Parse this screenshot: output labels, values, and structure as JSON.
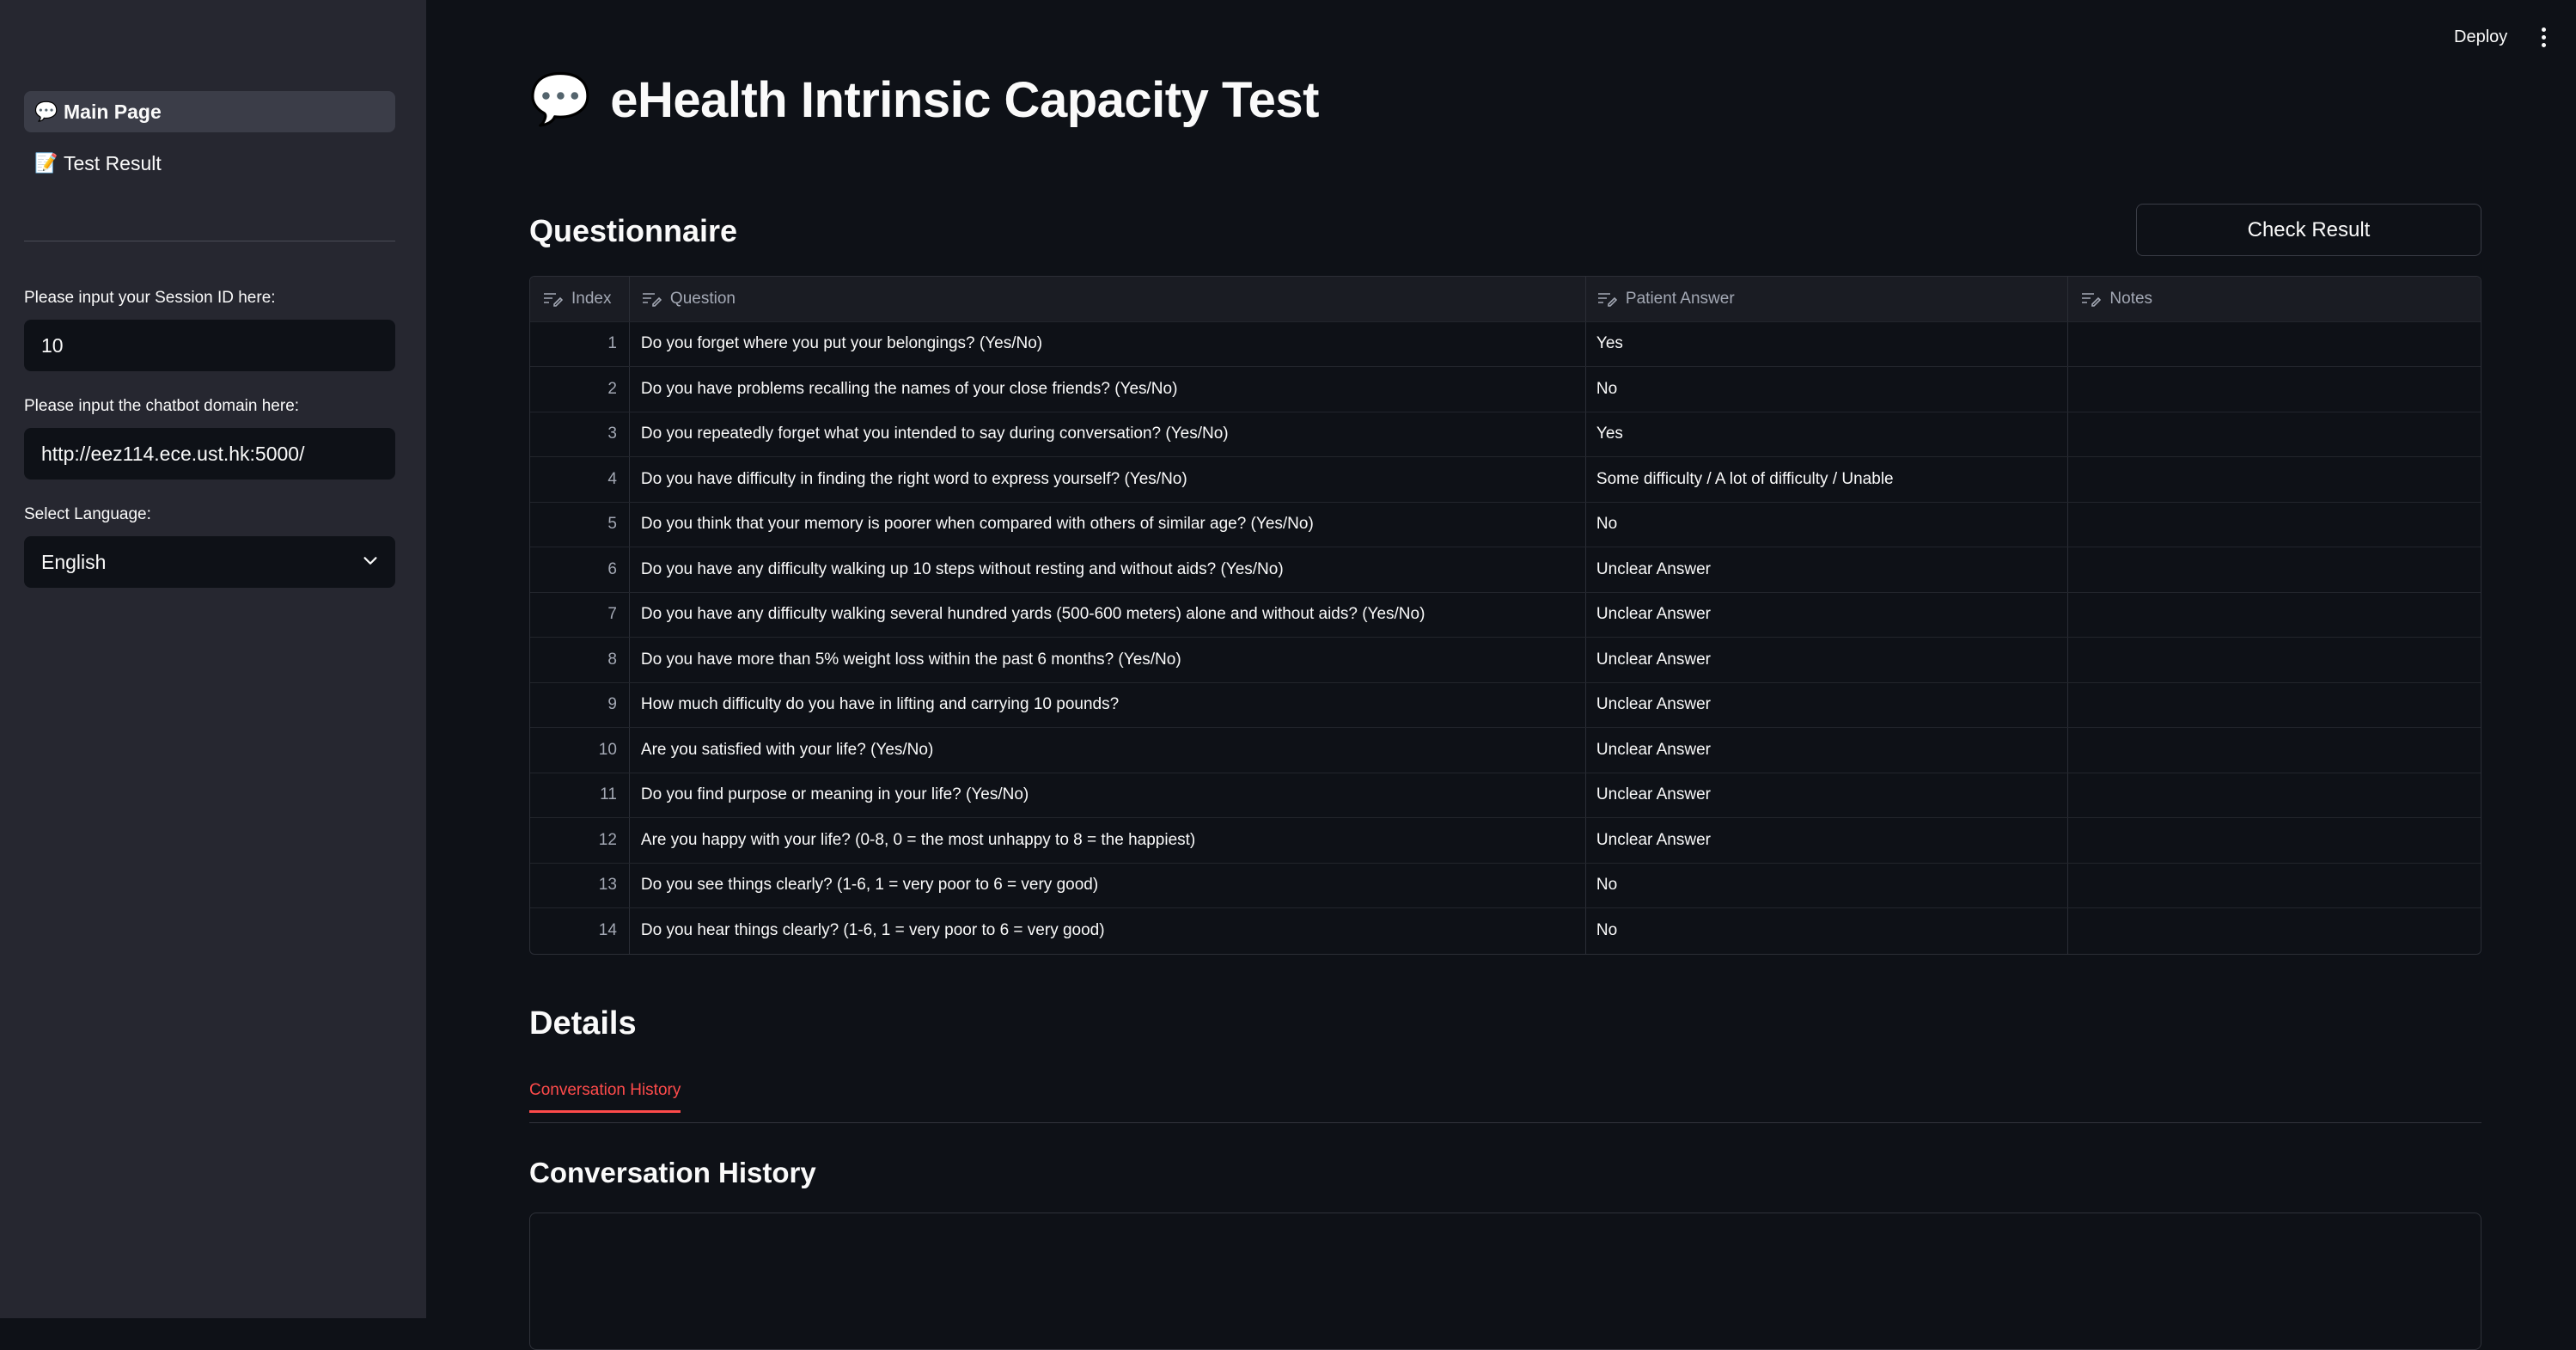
{
  "sidebar": {
    "nav": [
      {
        "icon": "💬",
        "label": "Main Page",
        "active": true
      },
      {
        "icon": "📝",
        "label": "Test Result",
        "active": false
      }
    ],
    "session_label": "Please input your Session ID here:",
    "session_value": "10",
    "domain_label": "Please input the chatbot domain here:",
    "domain_value": "http://eez114.ece.ust.hk:5000/",
    "language_label": "Select Language:",
    "language_value": "English"
  },
  "header": {
    "deploy": "Deploy",
    "menu_icon": "kebab-menu-icon"
  },
  "page": {
    "icon": "💬",
    "title": "eHealth Intrinsic Capacity Test"
  },
  "questionnaire": {
    "heading": "Questionnaire",
    "check_button": "Check Result",
    "columns": [
      "Index",
      "Question",
      "Patient Answer",
      "Notes"
    ],
    "rows": [
      {
        "index": "1",
        "question": "Do you forget where you put your belongings? (Yes/No)",
        "answer": "Yes",
        "notes": ""
      },
      {
        "index": "2",
        "question": "Do you have problems recalling the names of your close friends? (Yes/No)",
        "answer": "No",
        "notes": ""
      },
      {
        "index": "3",
        "question": "Do you repeatedly forget what you intended to say during conversation? (Yes/No)",
        "answer": "Yes",
        "notes": ""
      },
      {
        "index": "4",
        "question": "Do you have difficulty in finding the right word to express yourself? (Yes/No)",
        "answer": "Some difficulty / A lot of difficulty / Unable",
        "notes": ""
      },
      {
        "index": "5",
        "question": "Do you think that your memory is poorer when compared with others of similar age? (Yes/No)",
        "answer": "No",
        "notes": ""
      },
      {
        "index": "6",
        "question": "Do you have any difficulty walking up 10 steps without resting and without aids? (Yes/No)",
        "answer": "Unclear Answer",
        "notes": ""
      },
      {
        "index": "7",
        "question": "Do you have any difficulty walking several hundred yards (500-600 meters) alone and without aids? (Yes/No)",
        "answer": "Unclear Answer",
        "notes": ""
      },
      {
        "index": "8",
        "question": "Do you have more than 5% weight loss within the past 6 months? (Yes/No)",
        "answer": "Unclear Answer",
        "notes": ""
      },
      {
        "index": "9",
        "question": "How much difficulty do you have in lifting and carrying 10 pounds?",
        "answer": "Unclear Answer",
        "notes": ""
      },
      {
        "index": "10",
        "question": "Are you satisfied with your life? (Yes/No)",
        "answer": "Unclear Answer",
        "notes": ""
      },
      {
        "index": "11",
        "question": "Do you find purpose or meaning in your life? (Yes/No)",
        "answer": "Unclear Answer",
        "notes": ""
      },
      {
        "index": "12",
        "question": "Are you happy with your life? (0-8, 0 = the most unhappy to 8 = the happiest)",
        "answer": "Unclear Answer",
        "notes": ""
      },
      {
        "index": "13",
        "question": "Do you see things clearly? (1-6, 1 = very poor to 6 = very good)",
        "answer": "No",
        "notes": ""
      },
      {
        "index": "14",
        "question": "Do you hear things clearly? (1-6, 1 = very poor to 6 = very good)",
        "answer": "No",
        "notes": ""
      }
    ]
  },
  "details": {
    "heading": "Details",
    "tab": "Conversation History",
    "subheading": "Conversation History"
  },
  "colors": {
    "accent": "#ff4b4b",
    "background": "#0e1117",
    "sidebar": "#262730"
  }
}
